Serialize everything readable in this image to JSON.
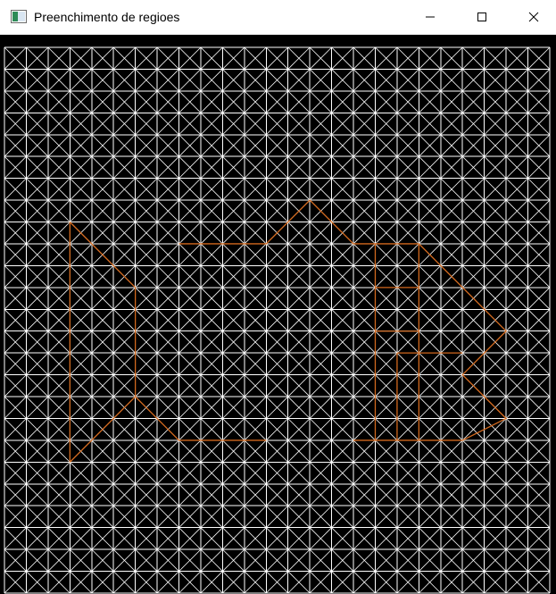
{
  "window": {
    "title": "Preenchimento de regioes",
    "controls": {
      "minimize": "minimize-icon",
      "maximize": "maximize-icon",
      "close": "close-icon"
    }
  },
  "canvas": {
    "background": "#000000",
    "grid": {
      "cols": 25,
      "rows": 25,
      "line_color": "#ffffff",
      "diagonals": true
    },
    "region_outline": {
      "color": "#d2691e",
      "paths": [
        [
          [
            3,
            8
          ],
          [
            6,
            11
          ],
          [
            6,
            16
          ],
          [
            3,
            19
          ]
        ],
        [
          [
            3,
            8
          ],
          [
            3,
            19
          ]
        ],
        [
          [
            6,
            16
          ],
          [
            8,
            18
          ],
          [
            12,
            18
          ]
        ],
        [
          [
            8,
            9
          ],
          [
            12,
            9
          ],
          [
            14,
            7
          ],
          [
            16,
            9
          ],
          [
            19,
            9
          ],
          [
            23,
            13
          ],
          [
            21,
            15
          ],
          [
            23,
            17
          ],
          [
            21,
            18
          ],
          [
            16,
            18
          ]
        ],
        [
          [
            17,
            9
          ],
          [
            17,
            18
          ]
        ],
        [
          [
            19,
            9
          ],
          [
            19,
            18
          ]
        ],
        [
          [
            17,
            11
          ],
          [
            19,
            11
          ]
        ],
        [
          [
            17,
            13
          ],
          [
            19,
            13
          ]
        ],
        [
          [
            18,
            14
          ],
          [
            21,
            14
          ]
        ],
        [
          [
            18,
            14
          ],
          [
            18,
            18
          ]
        ]
      ]
    }
  }
}
